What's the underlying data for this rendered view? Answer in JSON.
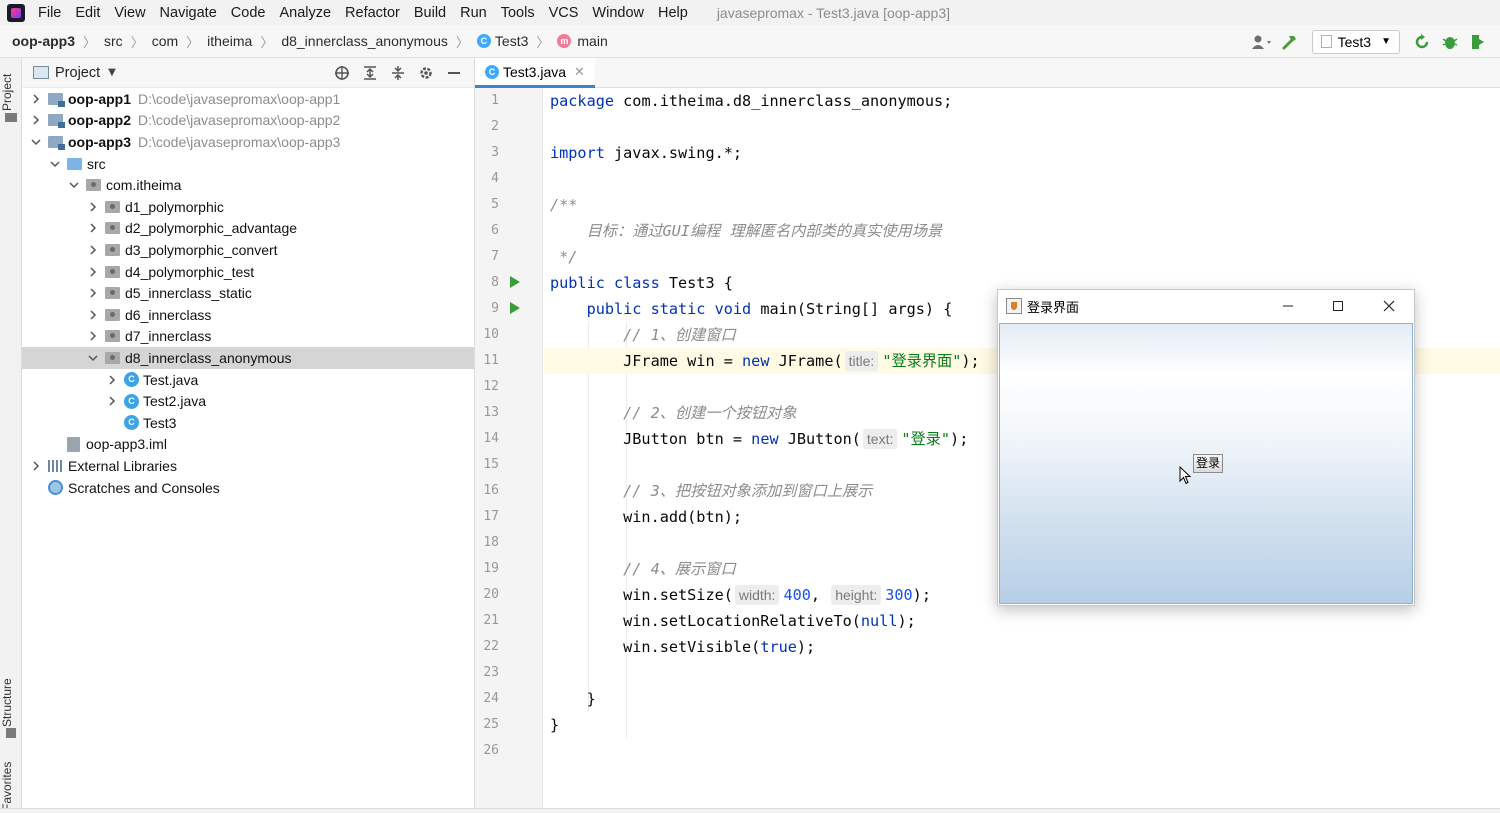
{
  "menu": {
    "items": [
      "File",
      "Edit",
      "View",
      "Navigate",
      "Code",
      "Analyze",
      "Refactor",
      "Build",
      "Run",
      "Tools",
      "VCS",
      "Window",
      "Help"
    ],
    "window_title": "javasepromax - Test3.java [oop-app3]"
  },
  "breadcrumb": {
    "items": [
      "oop-app3",
      "src",
      "com",
      "itheima",
      "d8_innerclass_anonymous",
      "Test3",
      "main"
    ],
    "icons": {
      "class": "C",
      "method": "m"
    }
  },
  "toolbar": {
    "run_config": "Test3"
  },
  "side_tabs": {
    "project": "Project",
    "structure": "Structure",
    "favorites": "Favorites"
  },
  "project": {
    "title": "Project",
    "tree": [
      {
        "label": "oop-app1",
        "path": "D:\\code\\javasepromax\\oop-app1"
      },
      {
        "label": "oop-app2",
        "path": "D:\\code\\javasepromax\\oop-app2"
      },
      {
        "label": "oop-app3",
        "path": "D:\\code\\javasepromax\\oop-app3"
      },
      {
        "label": "src"
      },
      {
        "label": "com.itheima"
      },
      {
        "label": "d1_polymorphic"
      },
      {
        "label": "d2_polymorphic_advantage"
      },
      {
        "label": "d3_polymorphic_convert"
      },
      {
        "label": "d4_polymorphic_test"
      },
      {
        "label": "d5_innerclass_static"
      },
      {
        "label": "d6_innerclass"
      },
      {
        "label": "d7_innerclass"
      },
      {
        "label": "d8_innerclass_anonymous"
      },
      {
        "label": "Test.java"
      },
      {
        "label": "Test2.java"
      },
      {
        "label": "Test3"
      },
      {
        "label": "oop-app3.iml"
      },
      {
        "label": "External Libraries"
      },
      {
        "label": "Scratches and Consoles"
      }
    ]
  },
  "editor": {
    "tab_label": "Test3.java",
    "line_numbers": [
      "1",
      "2",
      "3",
      "4",
      "5",
      "6",
      "7",
      "8",
      "9",
      "10",
      "11",
      "12",
      "13",
      "14",
      "15",
      "16",
      "17",
      "18",
      "19",
      "20",
      "21",
      "22",
      "23",
      "24",
      "25",
      "26"
    ],
    "code": {
      "l1_kw": "package",
      "l1_rest": " com.itheima.d8_innerclass_anonymous;",
      "l3_kw": "import",
      "l3_rest": " javax.swing.*;",
      "l5": "/**",
      "l6": "    目标：通过GUI编程 理解匿名内部类的真实使用场景",
      "l7": " */",
      "l8_kw": "public class",
      "l8_rest": " Test3 {",
      "l9_indent": "    ",
      "l9_kw": "public static void",
      "l9_rest": " main(String[] args) {",
      "l10": "        // 1、创建窗口",
      "l11_a": "        JFrame win = ",
      "l11_kw": "new",
      "l11_b": " JFrame(",
      "l11_hint": "title:",
      "l11_str": "\"登录界面\"",
      "l11_c": ");",
      "l13": "        // 2、创建一个按钮对象",
      "l14_a": "        JButton btn = ",
      "l14_kw": "new",
      "l14_b": " JButton(",
      "l14_hint": "text:",
      "l14_str": "\"登录\"",
      "l14_c": ");",
      "l16": "        // 3、把按钮对象添加到窗口上展示",
      "l17": "        win.add(btn);",
      "l19": "        // 4、展示窗口",
      "l20_a": "        win.setSize(",
      "l20_hint1": "width:",
      "l20_num1": "400",
      "l20_b": ", ",
      "l20_hint2": "height:",
      "l20_num2": "300",
      "l20_c": ");",
      "l21_a": "        win.setLocationRelativeTo(",
      "l21_kw": "null",
      "l21_b": ");",
      "l22_a": "        win.setVisible(",
      "l22_kw": "true",
      "l22_b": ");",
      "l24": "    }",
      "l25": "}"
    }
  },
  "swing_window": {
    "title": "登录界面",
    "button_label": "登录"
  },
  "colors": {
    "keyword": "#0033b3",
    "string": "#067d17",
    "comment": "#8c8c8c",
    "number": "#1750eb",
    "run_icon": "#3c9c3c",
    "current_line": "#fffae3",
    "selection": "#d5d5d5"
  }
}
